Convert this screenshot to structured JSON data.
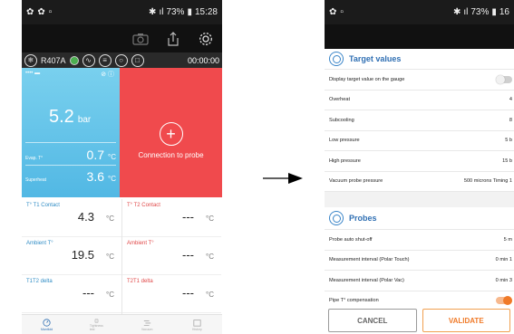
{
  "left_phone": {
    "status": {
      "battery": "73%",
      "time": "15:28"
    },
    "toolbar": {
      "refrigerant": "R407A",
      "timer": "00:00:00"
    },
    "blue_tile": {
      "pressure_value": "5.2",
      "pressure_unit": "bar",
      "evap_label": "Evap. T°",
      "evap_value": "0.7",
      "evap_unit": "°C",
      "superheat_label": "Superheat",
      "superheat_value": "3.6",
      "superheat_unit": "°C"
    },
    "red_tile": {
      "connection_label": "Connection to probe"
    },
    "cells_left": [
      {
        "label": "T° T1 Contact",
        "value": "4.3",
        "unit": "°C"
      },
      {
        "label": "Ambient T°",
        "value": "19.5",
        "unit": "°C"
      },
      {
        "label": "T1T2 delta",
        "value": "---",
        "unit": "°C"
      }
    ],
    "cells_right": [
      {
        "label": "T° T2 Contact",
        "value": "---",
        "unit": "°C"
      },
      {
        "label": "Ambient T°",
        "value": "---",
        "unit": "°C"
      },
      {
        "label": "T2T1 delta",
        "value": "---",
        "unit": "°C"
      }
    ],
    "nav": [
      "Manifold",
      "Tightness test",
      "Vacuum",
      "History"
    ]
  },
  "right_phone": {
    "status": {
      "battery": "73%",
      "time": "16"
    },
    "target_values": {
      "title": "Target values",
      "rows": [
        {
          "label": "Display target value on the gauge",
          "value": ""
        },
        {
          "label": "Overheat",
          "value": "4"
        },
        {
          "label": "Subcooling",
          "value": "8"
        },
        {
          "label": "Low pressure",
          "value": "5 b"
        },
        {
          "label": "High pressure",
          "value": "15 b"
        },
        {
          "label": "Vacuum probe pressure",
          "value": "500 microns   Timing   1"
        }
      ]
    },
    "probes": {
      "title": "Probes",
      "rows": [
        {
          "label": "Probe auto shut-off",
          "value": "5 m"
        },
        {
          "label": "Measurement interval (Polar Touch)",
          "value": "0 min 1"
        },
        {
          "label": "Measurement interval (Polar Vac)",
          "value": "0 min 3"
        },
        {
          "label": "Pipe T° compensation",
          "value": ""
        }
      ]
    },
    "buttons": {
      "cancel": "CANCEL",
      "validate": "VALIDATE"
    }
  },
  "colors": {
    "blue_tile": "#5ec2ea",
    "red_tile": "#f04a4d",
    "accent_blue": "#2f6fb3",
    "accent_orange": "#f07a28"
  }
}
